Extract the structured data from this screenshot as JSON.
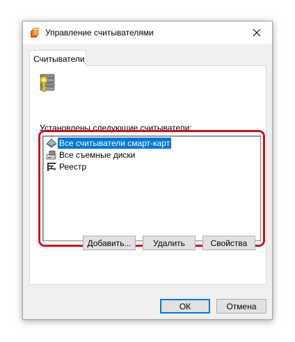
{
  "window": {
    "title": "Управление считывателями"
  },
  "tabs": [
    {
      "label": "Считыватели"
    }
  ],
  "readers": {
    "list_label": "Установлены следующие считыватели:",
    "items": [
      {
        "label": "Все считыватели смарт-карт",
        "icon": "smartcard-icon",
        "selected": true
      },
      {
        "label": "Все съемные диски",
        "icon": "removable-disk-icon",
        "selected": false
      },
      {
        "label": "Реестр",
        "icon": "registry-icon",
        "selected": false
      }
    ]
  },
  "buttons": {
    "add": "Добавить...",
    "remove": "Удалить",
    "properties": "Свойства",
    "ok": "ОК",
    "cancel": "Отмена"
  },
  "colors": {
    "selection": "#0078d7",
    "highlight_frame": "#d2101d"
  }
}
